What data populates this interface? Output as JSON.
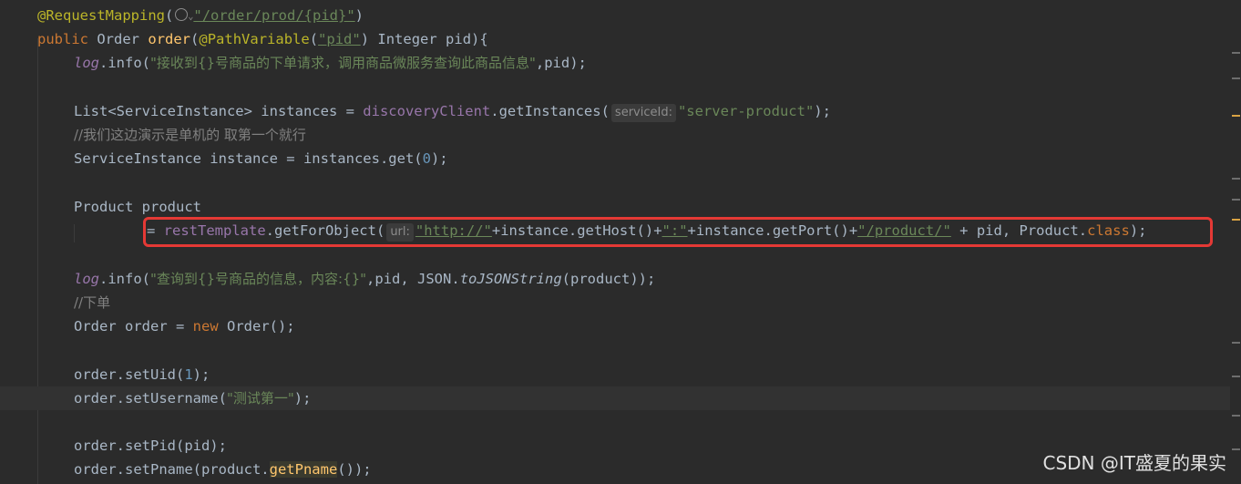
{
  "code": {
    "l1": {
      "annotation": "@RequestMapping",
      "path": "\"/order/prod/{pid}\"",
      "close": ")"
    },
    "l2": {
      "kw_public": "public",
      "type": "Order",
      "method": "order",
      "param_ann": "@PathVariable",
      "param_name": "\"pid\"",
      "rest": ") Integer pid){"
    },
    "l3": {
      "log": "log",
      "call": ".info(",
      "msg": "\"接收到{}号商品的下单请求，调用商品微服务查询此商品信息\"",
      "rest": ",pid);"
    },
    "l5": {
      "decl": "List<ServiceInstance> instances = ",
      "field": "discoveryClient",
      "call": ".getInstances(",
      "hint": "serviceId:",
      "arg": "\"server-product\"",
      "rest": ");"
    },
    "l6": {
      "comment": "//我们这边演示是单机的 取第一个就行"
    },
    "l7": {
      "decl": "ServiceInstance instance = instances.get(",
      "num": "0",
      "rest": ");"
    },
    "l9": {
      "decl": "Product product"
    },
    "l10": {
      "eq": "= ",
      "field": "restTemplate",
      "call": ".getForObject(",
      "hint": "url:",
      "s1": "\"http://\"",
      "p1": "+instance.getHost()+",
      "s2": "\":\"",
      "p2": "+instance.getPort()+",
      "s3": "\"/product/\"",
      "p3": " + pid, Product.",
      "kw_class": "class",
      "end": ");"
    },
    "l12": {
      "log": "log",
      "call": ".info(",
      "msg": "\"查询到{}号商品的信息，内容:{}\"",
      "mid": ",pid, JSON.",
      "static": "toJSONString",
      "rest": "(product));"
    },
    "l13": {
      "comment": "//下单"
    },
    "l14": {
      "decl": "Order order = ",
      "kw_new": "new",
      "rest": " Order();"
    },
    "l16": {
      "call": "order.setUid(",
      "num": "1",
      "rest": ");"
    },
    "l17": {
      "call": "order.setUsername(",
      "str": "\"测试第一\"",
      "rest": ");"
    },
    "l19": {
      "call": "order.setPid(pid);"
    },
    "l20": {
      "call": "order.setPname(product.",
      "hl": "getPname",
      "rest": "());"
    }
  },
  "watermark": "CSDN @IT盛夏的果实",
  "colors": {
    "highlight_box": "#e53935",
    "background": "#2b2b2b"
  }
}
